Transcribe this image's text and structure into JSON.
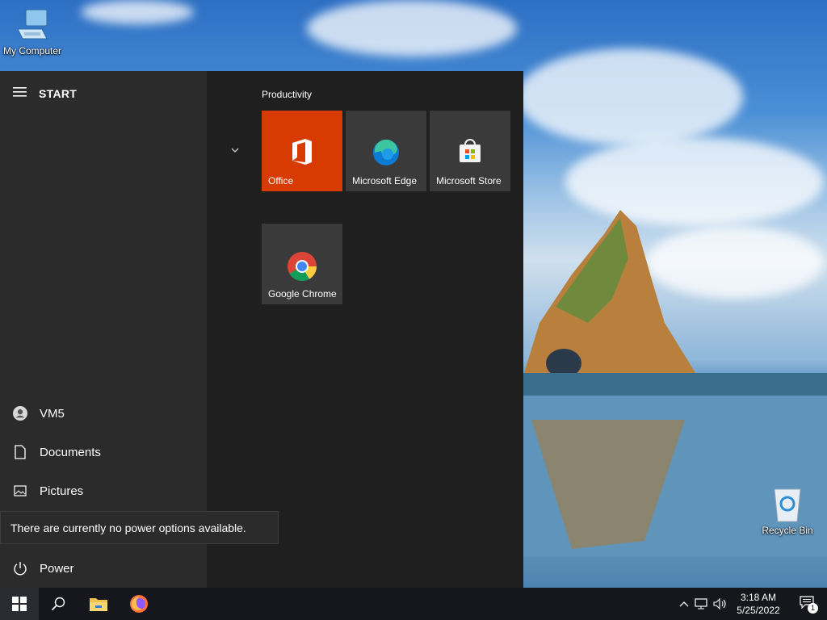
{
  "desktop": {
    "icons": [
      {
        "label": "My Computer",
        "icon": "computer-icon"
      },
      {
        "label": "Recycle Bin",
        "icon": "recycle-bin-icon"
      }
    ]
  },
  "start_menu": {
    "title": "START",
    "left_items": [
      {
        "label": "VM5",
        "icon": "user-avatar-icon"
      },
      {
        "label": "Documents",
        "icon": "document-icon"
      },
      {
        "label": "Pictures",
        "icon": "pictures-icon"
      },
      {
        "label": "Power",
        "icon": "power-icon"
      }
    ],
    "tooltip": "There are currently no power options available.",
    "group": {
      "label": "Productivity",
      "tiles": [
        {
          "label": "Office",
          "icon": "office-icon",
          "color": "#d83b01"
        },
        {
          "label": "Microsoft Edge",
          "icon": "edge-icon",
          "color": "#3a3a3a"
        },
        {
          "label": "Microsoft Store",
          "icon": "store-icon",
          "color": "#3a3a3a"
        },
        {
          "label": "Google Chrome",
          "icon": "chrome-icon",
          "color": "#3a3a3a"
        }
      ]
    }
  },
  "taskbar": {
    "pinned": [
      "start-icon",
      "search-icon",
      "file-explorer-icon",
      "firefox-icon"
    ],
    "clock": {
      "time": "3:18 AM",
      "date": "5/25/2022"
    },
    "notification_count": "1"
  }
}
